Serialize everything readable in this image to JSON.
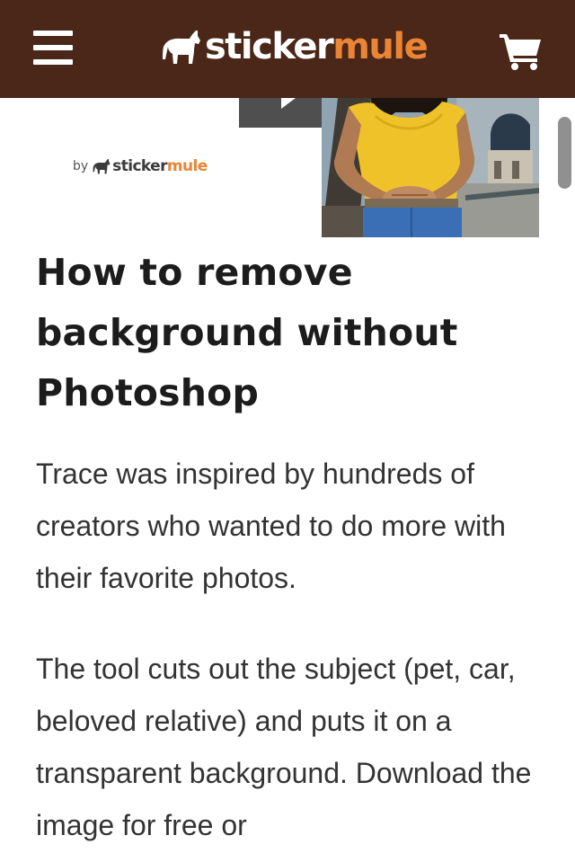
{
  "header": {
    "menu_icon": "hamburger-menu-icon",
    "logo": {
      "word1": "sticker",
      "word2": "mule",
      "icon": "mule-logo-icon"
    },
    "cart_icon": "shopping-cart-icon",
    "background": "#4a2718",
    "accent": "#e98535"
  },
  "hero": {
    "byline": {
      "prefix": "by",
      "word1": "sticker",
      "word2": "mule"
    },
    "play_icon": "play-icon"
  },
  "article": {
    "title": "How to remove background without Photoshop",
    "paragraphs": [
      "Trace was inspired by hundreds of creators who wanted to do more with their favorite photos.",
      "The tool cuts out the subject (pet, car, beloved relative) and puts it on a transparent background. Download the image for free or"
    ]
  }
}
